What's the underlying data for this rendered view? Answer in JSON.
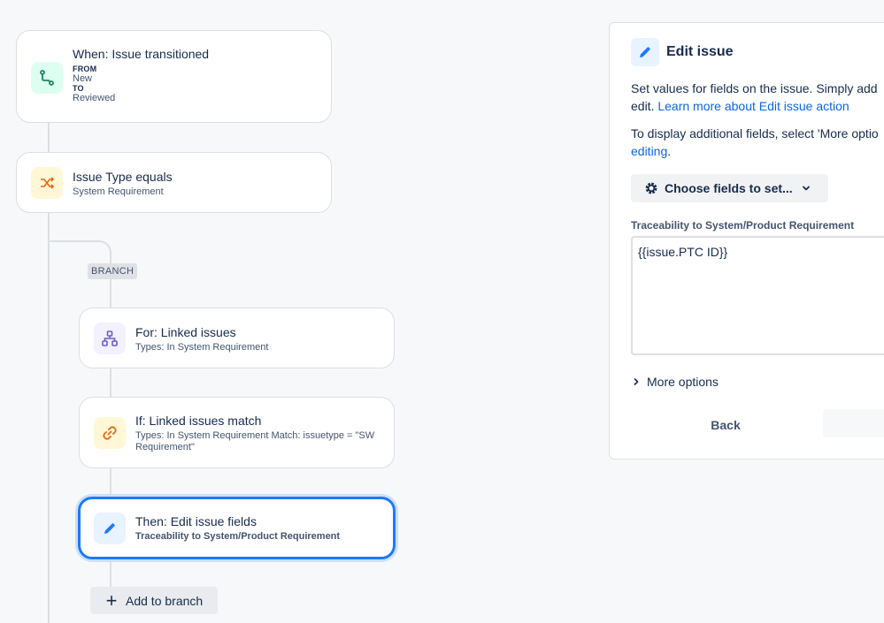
{
  "flow": {
    "trigger": {
      "title": "When: Issue transitioned",
      "from_label": "FROM",
      "from_value": "New",
      "to_label": "TO",
      "to_value": "Reviewed",
      "icon": "transition-icon"
    },
    "condition": {
      "title": "Issue Type equals",
      "subtitle": "System Requirement",
      "icon": "shuffle-icon"
    },
    "branch_tag": "BRANCH",
    "branch_for": {
      "title": "For: Linked issues",
      "subtitle": "Types: In System Requirement",
      "icon": "hierarchy-icon"
    },
    "branch_if": {
      "title": "If: Linked issues match",
      "subtitle": "Types: In System Requirement Match: issuetype = \"SW Requirement\"",
      "icon": "link-icon"
    },
    "branch_then": {
      "title": "Then: Edit issue fields",
      "subtitle": "Traceability to System/Product Requirement",
      "icon": "pencil-icon"
    },
    "add_to_branch_label": "Add to branch"
  },
  "panel": {
    "title": "Edit issue",
    "desc_line1": "Set values for fields on the issue. Simply add",
    "desc_line2_prefix": "edit.",
    "desc_link": "Learn more about Edit issue action",
    "display_line1": "To display additional fields, select 'More optio",
    "display_link": "editing",
    "display_suffix": ".",
    "choose_button": "Choose fields to set...",
    "field_label": "Traceability to System/Product Requirement",
    "field_value": "{{issue.PTC ID}}",
    "more_options": "More options",
    "back_button": "Back"
  },
  "colors": {
    "accent": "#1d7afc",
    "link": "#0c66e4",
    "trigger_icon_bg": "#dcfff1",
    "condition_icon_bg": "#fff7d6",
    "branch_icon_bg": "#f3f0ff",
    "action_icon_bg": "#e9f2ff"
  }
}
